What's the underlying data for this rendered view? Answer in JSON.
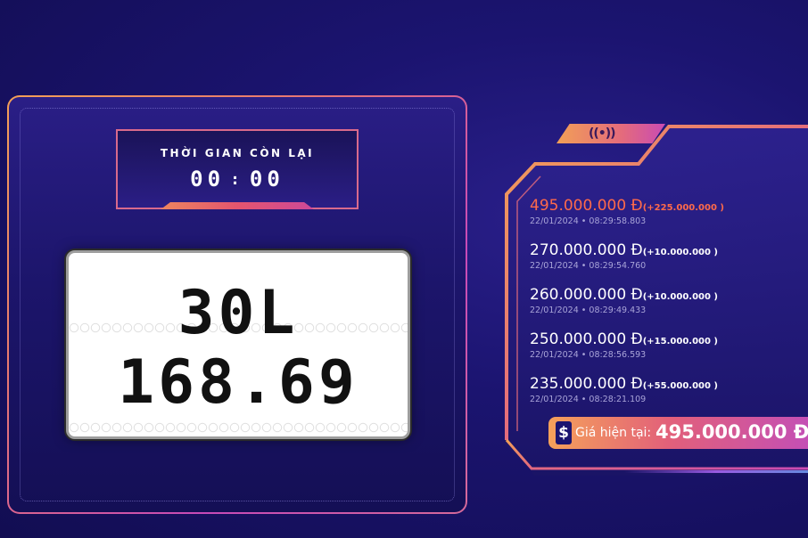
{
  "timer": {
    "label": "THỜI GIAN CÒN LẠI",
    "minutes": "00",
    "separator": ":",
    "seconds": "00"
  },
  "plate": {
    "line1": "30L",
    "line2": "168.69"
  },
  "live_icon": "broadcast-icon",
  "bids": [
    {
      "amount": "495.000.000 Đ",
      "increment": "(+225.000.000 )",
      "time": "22/01/2024 • 08:29:58.803"
    },
    {
      "amount": "270.000.000 Đ",
      "increment": "(+10.000.000 )",
      "time": "22/01/2024 • 08:29:54.760"
    },
    {
      "amount": "260.000.000 Đ",
      "increment": "(+10.000.000 )",
      "time": "22/01/2024 • 08:29:49.433"
    },
    {
      "amount": "250.000.000 Đ",
      "increment": "(+15.000.000 )",
      "time": "22/01/2024 • 08:28:56.593"
    },
    {
      "amount": "235.000.000 Đ",
      "increment": "(+55.000.000 )",
      "time": "22/01/2024 • 08:28:21.109"
    }
  ],
  "current_price": {
    "icon": "dollar-icon",
    "label": "Giá hiện tại:",
    "value": "495.000.000 Đ"
  },
  "colors": {
    "background": "#1b1470",
    "accent_orange": "#f2a056",
    "accent_pink": "#c84ab8",
    "top_bid": "#ff6a4a"
  }
}
